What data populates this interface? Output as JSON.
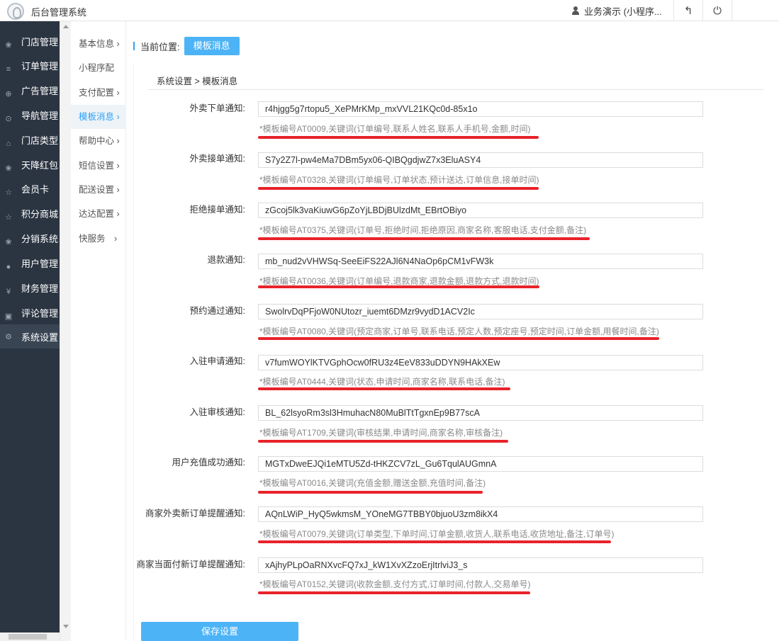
{
  "header": {
    "app_title": "后台管理系统",
    "user_name": "业务演示 (小程序...",
    "back_icon": "↰",
    "power_icon": "⏻"
  },
  "sidebar": {
    "items": [
      {
        "label": "门店管理",
        "icon": "store-icon"
      },
      {
        "label": "订单管理",
        "icon": "list-icon"
      },
      {
        "label": "广告管理",
        "icon": "globe-icon"
      },
      {
        "label": "导航管理",
        "icon": "compass-icon"
      },
      {
        "label": "门店类型",
        "icon": "bank-icon"
      },
      {
        "label": "天降红包",
        "icon": "group-icon"
      },
      {
        "label": "会员卡",
        "icon": "star-icon"
      },
      {
        "label": "积分商城",
        "icon": "star-icon"
      },
      {
        "label": "分销系统",
        "icon": "group-icon"
      },
      {
        "label": "用户管理",
        "icon": "user-icon"
      },
      {
        "label": "财务管理",
        "icon": "yen-icon"
      },
      {
        "label": "评论管理",
        "icon": "comment-icon"
      },
      {
        "label": "系统设置",
        "icon": "gear-icon"
      }
    ]
  },
  "submenu": {
    "items": [
      {
        "label": "基本信息 ›"
      },
      {
        "label": "小程序配"
      },
      {
        "label": "支付配置 ›"
      },
      {
        "label": "模板消息 ›"
      },
      {
        "label": "帮助中心 ›"
      },
      {
        "label": "短信设置 ›"
      },
      {
        "label": "配送设置 ›"
      },
      {
        "label": "达达配置 ›"
      },
      {
        "label": "快服务　›"
      }
    ]
  },
  "location": {
    "label": "当前位置:",
    "tab": "模板消息"
  },
  "breadcrumb": "系统设置 > 模板消息",
  "templates": [
    {
      "label": "外卖下单通知:",
      "value": "r4hjgg5g7rtopu5_XePMrKMp_mxVVL21KQc0d-85x1o",
      "hint": "*模板编号AT0009,关键词(订单编号,联系人姓名,联系人手机号,金额,时间)"
    },
    {
      "label": "外卖接单通知:",
      "value": "S7y2Z7l-pw4eMa7DBm5yx06-QIBQgdjwZ7x3EluASY4",
      "hint": "*模板编号AT0328,关键词(订单编号,订单状态,预计送达,订单信息,接单时间)"
    },
    {
      "label": "拒绝接单通知:",
      "value": "zGcoj5lk3vaKiuwG6pZoYjLBDjBUlzdMt_EBrtOBiyo",
      "hint": "*模板编号AT0375,关键词(订单号,拒绝时间,拒绝原因,商家名称,客服电话,支付金额,备注)"
    },
    {
      "label": "退款通知:",
      "value": "mb_nud2vVHWSq-SeeEiFS22AJl6N4NaOp6pCM1vFW3k",
      "hint": "*模板编号AT0036,关键词(订单编号,退款商家,退款金额,退款方式,退款时间)"
    },
    {
      "label": "预约通过通知:",
      "value": "SwolrvDqPFjoW0NUtozr_iuemt6DMzr9vydD1ACV2Ic",
      "hint": "*模板编号AT0080,关键词(预定商家,订单号,联系电话,预定人数,预定座号,预定时间,订单金额,用餐时间,备注)"
    },
    {
      "label": "入驻申请通知:",
      "value": "v7fumWOYlKTVGphOcw0fRU3z4EeV833uDDYN9HAkXEw",
      "hint": "*模板编号AT0444,关键词(状态,申请时间,商家名称,联系电话,备注)"
    },
    {
      "label": "入驻审核通知:",
      "value": "BL_62lsyoRm3sl3HmuhacN80MuBlTtTgxnEp9B77scA",
      "hint": "*模板编号AT1709,关键词(审核结果,申请时间,商家名称,审核备注)"
    },
    {
      "label": "用户充值成功通知:",
      "value": "MGTxDweEJQi1eMTU5Zd-tHKZCV7zL_Gu6TqulAUGmnA",
      "hint": "*模板编号AT0016,关键词(充值金额,赠送金额,充值时间,备注)"
    },
    {
      "label": "商家外卖新订单提醒通知:",
      "value": "AQnLWiP_HyQ5wkmsM_YOneMG7TBBY0bjuoU3zm8ikX4",
      "hint": "*模板编号AT0079,关键词(订单类型,下单时间,订单金额,收货人,联系电话,收货地址,备注,订单号)"
    },
    {
      "label": "商家当面付新订单提醒通知:",
      "value": "xAjhyPLpOaRNXvcFQ7xJ_kW1XvXZzoErjItrlviJ3_s",
      "hint": "*模板编号AT0152,关键词(收款金额,支付方式,订单时间,付款人,交易单号)"
    }
  ],
  "save_label": "保存设置",
  "colors": {
    "sidebar_bg": "#2b3542",
    "accent": "#4cb3f6",
    "underline": "#e8232a"
  }
}
